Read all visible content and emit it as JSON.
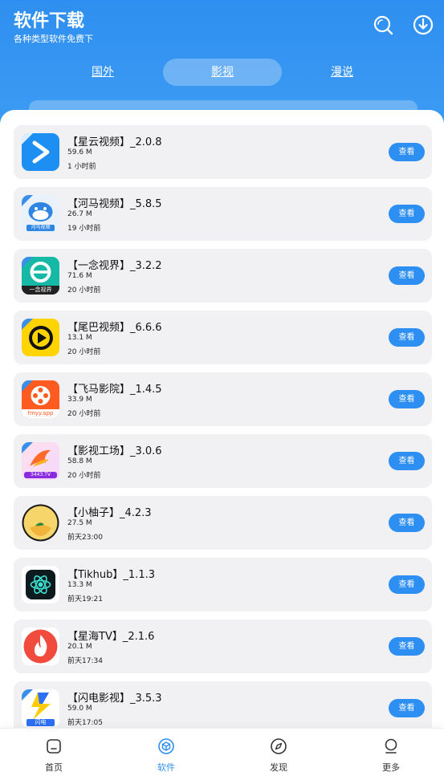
{
  "header": {
    "title": "软件下载",
    "subtitle": "各种类型软件免费下",
    "search_icon": "search-icon",
    "download_icon": "download-icon"
  },
  "tabs": [
    {
      "label": "国外",
      "active": false
    },
    {
      "label": "影视",
      "active": true
    },
    {
      "label": "漫说",
      "active": false
    }
  ],
  "apps": [
    {
      "name": "【星云视频】_2.0.8",
      "size": "59.6 M",
      "time": "1 小时前",
      "button": "查看",
      "icon": "play-arrow-icon"
    },
    {
      "name": "【河马视频】_5.8.5",
      "size": "26.7 M",
      "time": "19 小时前",
      "button": "查看",
      "icon": "hippo-icon",
      "icon_text": "河马视频"
    },
    {
      "name": "【一念视界】_3.2.2",
      "size": "71.6 M",
      "time": "20 小时前",
      "button": "查看",
      "icon": "swirl-e-icon",
      "icon_text": "一念视界"
    },
    {
      "name": "【尾巴视频】_6.6.6",
      "size": "13.1 M",
      "time": "20 小时前",
      "button": "查看",
      "icon": "play-circle-icon"
    },
    {
      "name": "【飞马影院】_1.4.5",
      "size": "33.9 M",
      "time": "20 小时前",
      "button": "查看",
      "icon": "film-reel-icon",
      "icon_text": "fmyy.app"
    },
    {
      "name": "【影视工场】_3.0.6",
      "size": "58.8 M",
      "time": "20 小时前",
      "button": "查看",
      "icon": "flame-bird-icon",
      "icon_text": "3443.TV"
    },
    {
      "name": "【小柚子】_4.2.3",
      "size": "27.5 M",
      "time": "前天23:00",
      "button": "查看",
      "icon": "pomelo-icon"
    },
    {
      "name": "【Tikhub】_1.1.3",
      "size": "13.3 M",
      "time": "前天19:21",
      "button": "查看",
      "icon": "atom-icon"
    },
    {
      "name": "【星海TV】_2.1.6",
      "size": "20.1 M",
      "time": "前天17:34",
      "button": "查看",
      "icon": "flame-icon"
    },
    {
      "name": "【闪电影视】_3.5.3",
      "size": "59.0 M",
      "time": "前天17:05",
      "button": "查看",
      "icon": "lightning-icon",
      "icon_text": "闪电"
    }
  ],
  "bottom_nav": [
    {
      "label": "首页",
      "icon": "home-icon",
      "active": false
    },
    {
      "label": "软件",
      "icon": "cube-icon",
      "active": true
    },
    {
      "label": "发现",
      "icon": "compass-icon",
      "active": false
    },
    {
      "label": "更多",
      "icon": "profile-icon",
      "active": false
    }
  ],
  "colors": {
    "primary": "#2d8ff2",
    "header_bg": "#3596f2",
    "card_bg": "#f1f1f3"
  }
}
